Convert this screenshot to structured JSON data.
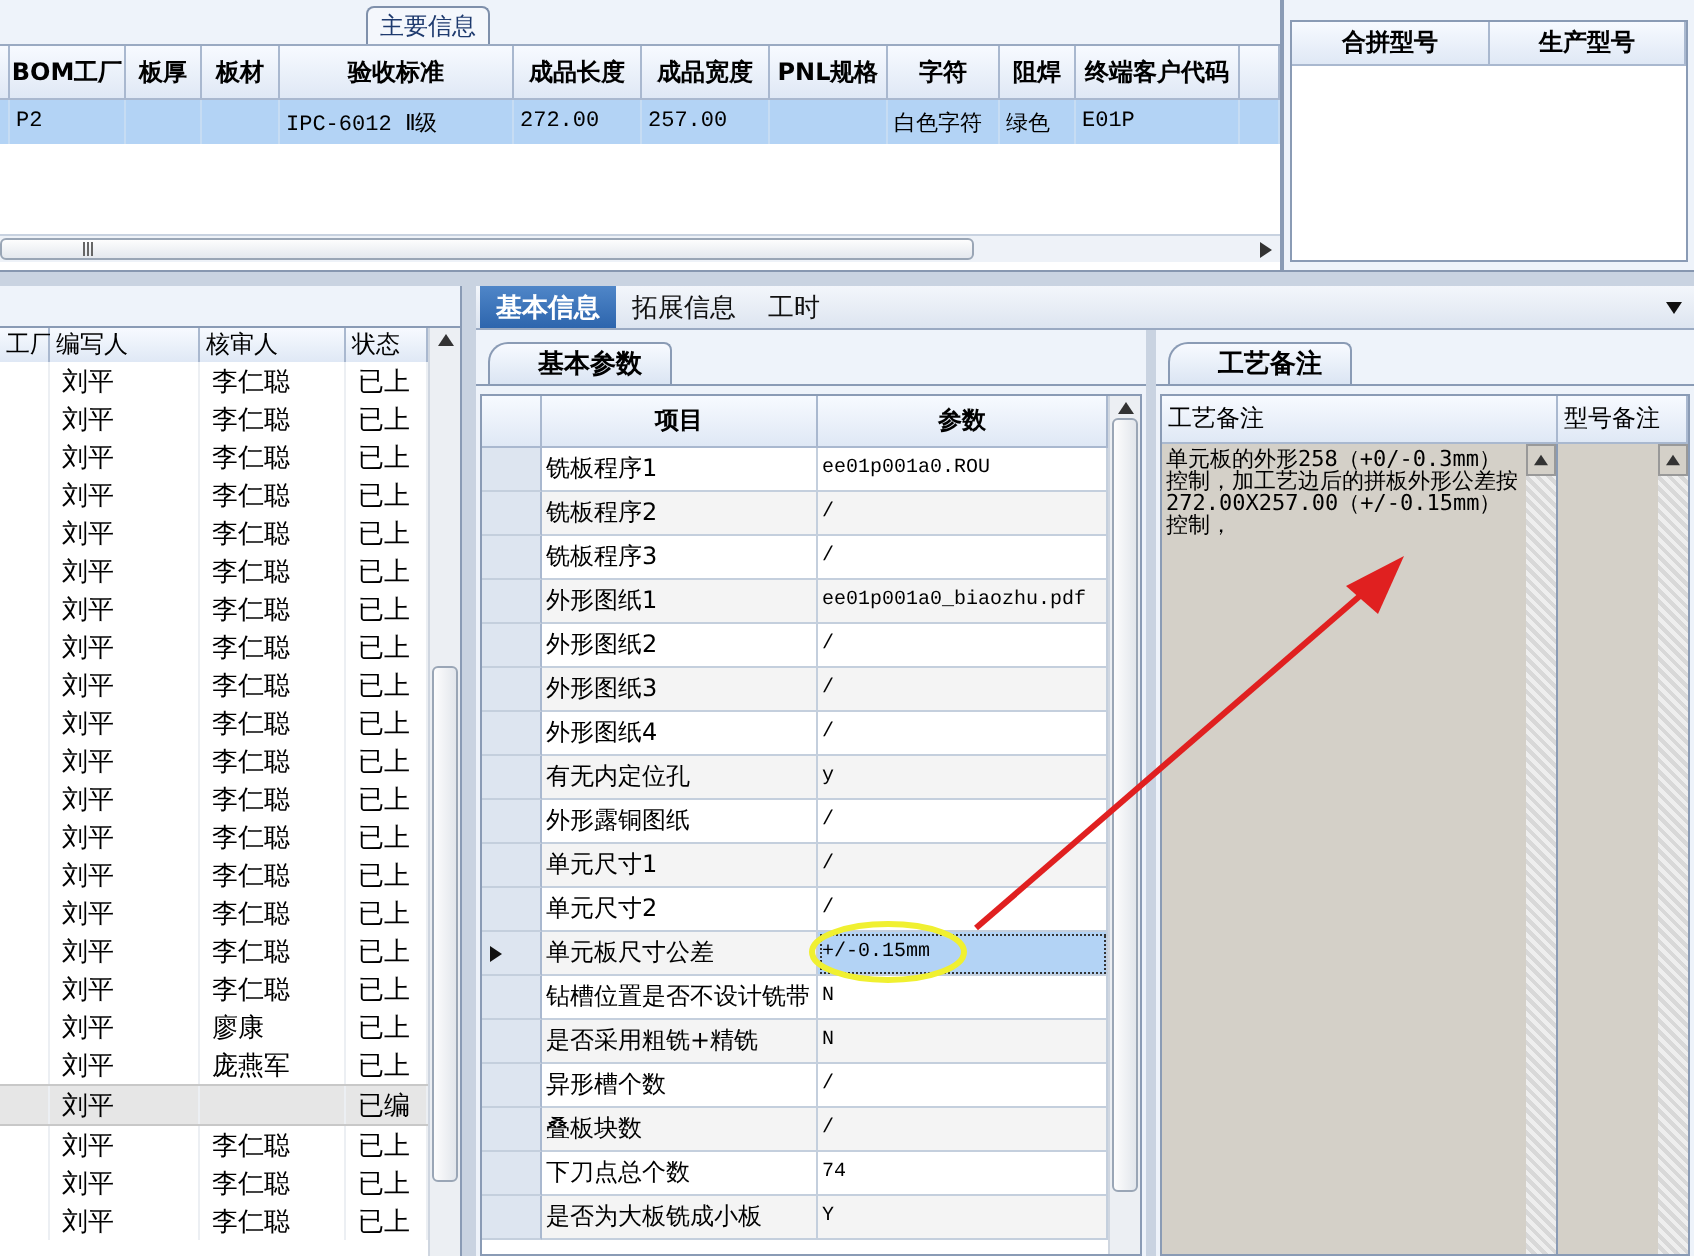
{
  "main_info": {
    "title": "主要信息",
    "columns": [
      "",
      "BOM工厂",
      "板厚",
      "板材",
      "验收标准",
      "成品长度",
      "成品宽度",
      "PNL规格",
      "字符",
      "阻焊",
      "终端客户代码"
    ],
    "rows": [
      {
        "cells": [
          "",
          "P2",
          "",
          "",
          "IPC-6012 Ⅱ级",
          "272.00",
          "257.00",
          "",
          "白色字符",
          "绿色",
          "E01P"
        ],
        "selected": true
      }
    ]
  },
  "model_grid": {
    "columns": [
      "合拼型号",
      "生产型号"
    ]
  },
  "list": {
    "columns": [
      "工厂",
      "编写人",
      "核审人",
      "状态"
    ],
    "rows": [
      {
        "cells": [
          "",
          "刘平",
          "李仁聪",
          "已上"
        ],
        "selected": false
      },
      {
        "cells": [
          "",
          "刘平",
          "李仁聪",
          "已上"
        ],
        "selected": false
      },
      {
        "cells": [
          "",
          "刘平",
          "李仁聪",
          "已上"
        ],
        "selected": false
      },
      {
        "cells": [
          "",
          "刘平",
          "李仁聪",
          "已上"
        ],
        "selected": false
      },
      {
        "cells": [
          "",
          "刘平",
          "李仁聪",
          "已上"
        ],
        "selected": false
      },
      {
        "cells": [
          "",
          "刘平",
          "李仁聪",
          "已上"
        ],
        "selected": false
      },
      {
        "cells": [
          "",
          "刘平",
          "李仁聪",
          "已上"
        ],
        "selected": false
      },
      {
        "cells": [
          "",
          "刘平",
          "李仁聪",
          "已上"
        ],
        "selected": false
      },
      {
        "cells": [
          "",
          "刘平",
          "李仁聪",
          "已上"
        ],
        "selected": false
      },
      {
        "cells": [
          "",
          "刘平",
          "李仁聪",
          "已上"
        ],
        "selected": false
      },
      {
        "cells": [
          "",
          "刘平",
          "李仁聪",
          "已上"
        ],
        "selected": false
      },
      {
        "cells": [
          "",
          "刘平",
          "李仁聪",
          "已上"
        ],
        "selected": false
      },
      {
        "cells": [
          "",
          "刘平",
          "李仁聪",
          "已上"
        ],
        "selected": false
      },
      {
        "cells": [
          "",
          "刘平",
          "李仁聪",
          "已上"
        ],
        "selected": false
      },
      {
        "cells": [
          "",
          "刘平",
          "李仁聪",
          "已上"
        ],
        "selected": false
      },
      {
        "cells": [
          "",
          "刘平",
          "李仁聪",
          "已上"
        ],
        "selected": false
      },
      {
        "cells": [
          "",
          "刘平",
          "李仁聪",
          "已上"
        ],
        "selected": false
      },
      {
        "cells": [
          "",
          "刘平",
          "廖康",
          "已上"
        ],
        "selected": false
      },
      {
        "cells": [
          "",
          "刘平",
          "庞燕军",
          "已上"
        ],
        "selected": false
      },
      {
        "cells": [
          "",
          "刘平",
          "",
          "已编"
        ],
        "selected": true
      },
      {
        "cells": [
          "",
          "刘平",
          "李仁聪",
          "已上"
        ],
        "selected": false
      },
      {
        "cells": [
          "",
          "刘平",
          "李仁聪",
          "已上"
        ],
        "selected": false
      },
      {
        "cells": [
          "",
          "刘平",
          "李仁聪",
          "已上"
        ],
        "selected": false
      }
    ]
  },
  "tabs": [
    {
      "label": "基本信息",
      "selected": true
    },
    {
      "label": "拓展信息",
      "selected": false
    },
    {
      "label": "工时",
      "selected": false
    }
  ],
  "params_tab": "基本参数",
  "params": {
    "columns": [
      "项目",
      "参数"
    ],
    "rows": [
      {
        "item": "铣板程序1",
        "value": "ee01p001a0.ROU",
        "current": false
      },
      {
        "item": "铣板程序2",
        "value": "/",
        "current": false
      },
      {
        "item": "铣板程序3",
        "value": "/",
        "current": false
      },
      {
        "item": "外形图纸1",
        "value": "ee01p001a0_biaozhu.pdf",
        "current": false
      },
      {
        "item": "外形图纸2",
        "value": "/",
        "current": false
      },
      {
        "item": "外形图纸3",
        "value": "/",
        "current": false
      },
      {
        "item": "外形图纸4",
        "value": "/",
        "current": false
      },
      {
        "item": "有无内定位孔",
        "value": "y",
        "current": false
      },
      {
        "item": "外形露铜图纸",
        "value": "/",
        "current": false
      },
      {
        "item": "单元尺寸1",
        "value": "/",
        "current": false
      },
      {
        "item": "单元尺寸2",
        "value": "/",
        "current": false
      },
      {
        "item": "单元板尺寸公差",
        "value": "+/-0.15mm",
        "current": true
      },
      {
        "item": "钻槽位置是否不设计铣带",
        "value": "N",
        "current": false
      },
      {
        "item": "是否采用粗铣+精铣",
        "value": "N",
        "current": false
      },
      {
        "item": "异形槽个数",
        "value": "/",
        "current": false
      },
      {
        "item": "叠板块数",
        "value": "/",
        "current": false
      },
      {
        "item": "下刀点总个数",
        "value": "74",
        "current": false
      },
      {
        "item": "是否为大板铣成小板",
        "value": "Y",
        "current": false
      }
    ]
  },
  "notes_tab": "工艺备注",
  "notes": {
    "columns": [
      "工艺备注",
      "型号备注"
    ],
    "process_note": "单元板的外形258（+0/-0.3mm）控制，加工艺边后的拼板外形公差按272.00X257.00（+/-0.15mm）控制，"
  }
}
